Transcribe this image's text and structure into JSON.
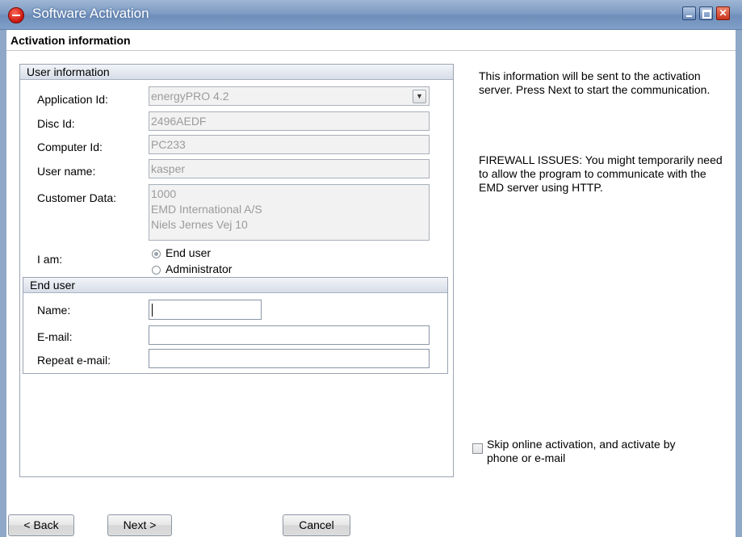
{
  "window": {
    "title": "Software Activation"
  },
  "page": {
    "title": "Activation information"
  },
  "user_info": {
    "header": "User information",
    "application_id": {
      "label": "Application Id:",
      "value": "energyPRO 4.2"
    },
    "disc_id": {
      "label": "Disc Id:",
      "value": "2496AEDF"
    },
    "computer_id": {
      "label": "Computer Id:",
      "value": "PC233"
    },
    "user_name": {
      "label": "User name:",
      "value": "kasper"
    },
    "customer_data": {
      "label": "Customer Data:",
      "value": "1000\nEMD International A/S\nNiels Jernes Vej 10"
    },
    "i_am": {
      "label": "I am:",
      "options": [
        "End user",
        "Administrator"
      ],
      "selected": "End user"
    }
  },
  "end_user": {
    "header": "End user",
    "name": {
      "label": "Name:",
      "value": ""
    },
    "email": {
      "label": "E-mail:",
      "value": ""
    },
    "repeat_email": {
      "label": "Repeat e-mail:",
      "value": ""
    }
  },
  "info": {
    "paragraph1": "This information will be sent to the activation server. Press Next to start the communication.",
    "paragraph2": "FIREWALL ISSUES: You might temporarily need to allow the program to communicate with the EMD server using HTTP."
  },
  "skip_online": {
    "label": "Skip online activation, and activate by phone or e-mail",
    "checked": false
  },
  "buttons": {
    "back": "< Back",
    "next": "Next >",
    "cancel": "Cancel"
  }
}
